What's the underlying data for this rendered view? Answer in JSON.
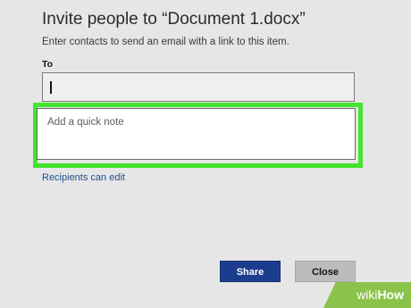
{
  "dialog": {
    "title": "Invite people to “Document 1.docx”",
    "subtitle": "Enter contacts to send an email with a link to this item.",
    "to_label": "To",
    "to_value": "",
    "note_placeholder": "Add a quick note",
    "permission_link": "Recipients can edit",
    "share_label": "Share",
    "close_label": "Close"
  },
  "watermark": {
    "text_wiki": "wiki",
    "text_how": "How"
  },
  "colors": {
    "highlight": "#43e32f",
    "share_button": "#1c3d8e",
    "link": "#1e4e8c",
    "watermark_bg": "#8bc34a"
  }
}
